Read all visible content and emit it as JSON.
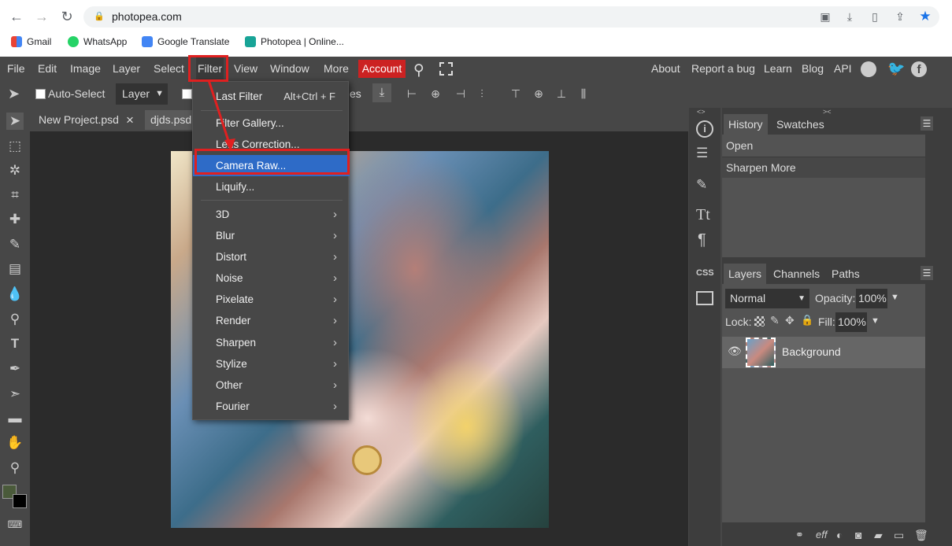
{
  "browser": {
    "url": "photopea.com",
    "bookmarks": [
      "Gmail",
      "WhatsApp",
      "Google Translate",
      "Photopea | Online..."
    ]
  },
  "menubar": {
    "items": [
      "File",
      "Edit",
      "Image",
      "Layer",
      "Select",
      "Filter",
      "View",
      "Window",
      "More"
    ],
    "account": "Account",
    "right_links": [
      "About",
      "Report a bug",
      "Learn",
      "Blog",
      "API"
    ]
  },
  "options": {
    "auto_select": "Auto-Select",
    "layer_select": "Layer",
    "transform_partial": "es"
  },
  "tabs": [
    {
      "label": "New Project.psd",
      "close": "×"
    },
    {
      "label": "djds.psd"
    }
  ],
  "filter_menu": {
    "last_filter": "Last Filter",
    "last_filter_shortcut": "Alt+Ctrl + F",
    "items": [
      "Filter Gallery...",
      "Lens Correction...",
      "Camera Raw...",
      "Liquify..."
    ],
    "highlighted": "Camera Raw...",
    "submenus": [
      "3D",
      "Blur",
      "Distort",
      "Noise",
      "Pixelate",
      "Render",
      "Sharpen",
      "Stylize",
      "Other",
      "Fourier"
    ]
  },
  "history_panel": {
    "tabs": [
      "History",
      "Swatches"
    ],
    "entries": [
      "Open",
      "Sharpen More"
    ]
  },
  "layers_panel": {
    "tabs": [
      "Layers",
      "Channels",
      "Paths"
    ],
    "blend_mode": "Normal",
    "opacity_label": "Opacity:",
    "opacity_value": "100%",
    "lock_label": "Lock:",
    "fill_label": "Fill:",
    "fill_value": "100%",
    "layers": [
      {
        "name": "Background"
      }
    ]
  },
  "colors": {
    "accent_highlight": "#2e6bc7",
    "account_red": "#cc2222",
    "annotation_red": "#e02020",
    "foreground_swatch": "#4a5a3a",
    "background_swatch": "#000000"
  },
  "side_icons": [
    "info-icon",
    "sliders-icon",
    "brush-icon",
    "text-icon",
    "paragraph-icon",
    "css-icon",
    "image-icon"
  ],
  "css_label": "CSS"
}
